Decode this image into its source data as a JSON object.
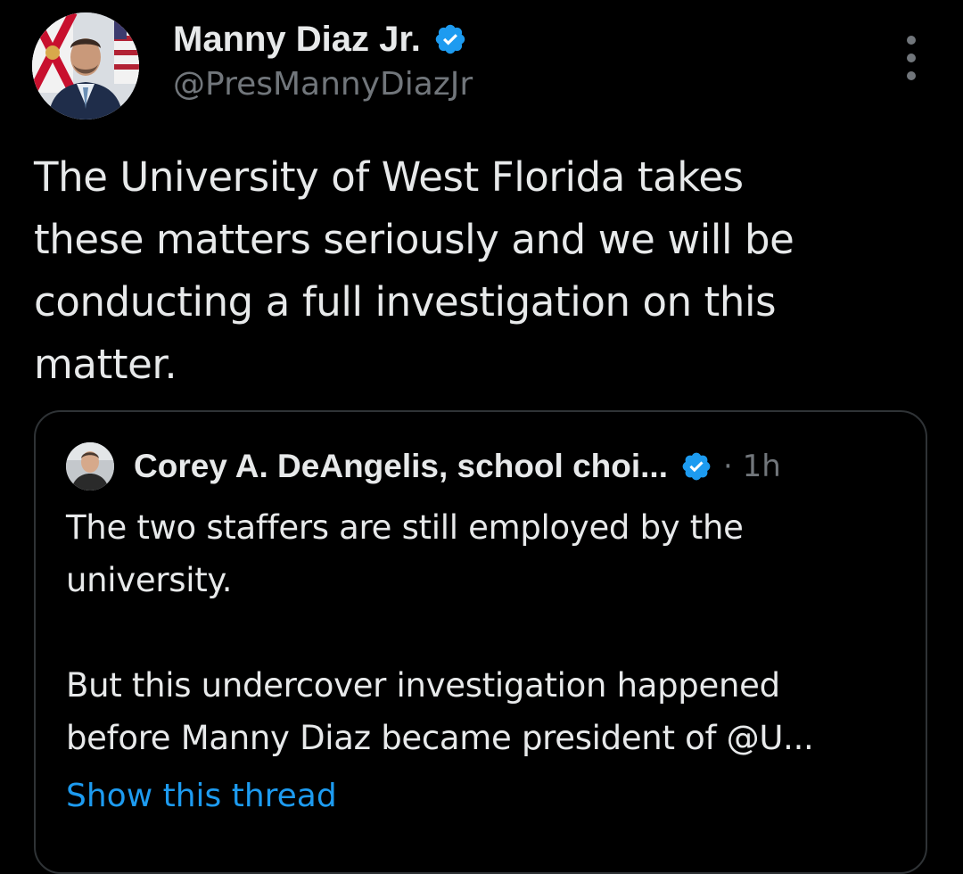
{
  "colors": {
    "background": "#000000",
    "primary_text": "#e7e9ea",
    "secondary_text": "#71767b",
    "accent_link": "#1d9bf0",
    "verified_badge": "#1d9bf0",
    "border": "#2f3336"
  },
  "tweet": {
    "author": {
      "display_name": "Manny Diaz Jr.",
      "handle": "@PresMannyDiazJr",
      "verified_icon": "verified-badge-icon"
    },
    "more_icon": "more-options-icon",
    "text": "The University of West Florida takes\nthese matters seriously and we will be\nconducting a full investigation on this\nmatter."
  },
  "quoted_tweet": {
    "author": {
      "display_name": "Corey A. DeAngelis, school choi...",
      "verified_icon": "verified-badge-icon"
    },
    "timestamp": "· 1h",
    "text": "The two staffers are still employed by the\nuniversity.\n\nBut this undercover investigation happened\nbefore Manny Diaz became president of @U...",
    "show_thread_label": "Show this thread"
  }
}
